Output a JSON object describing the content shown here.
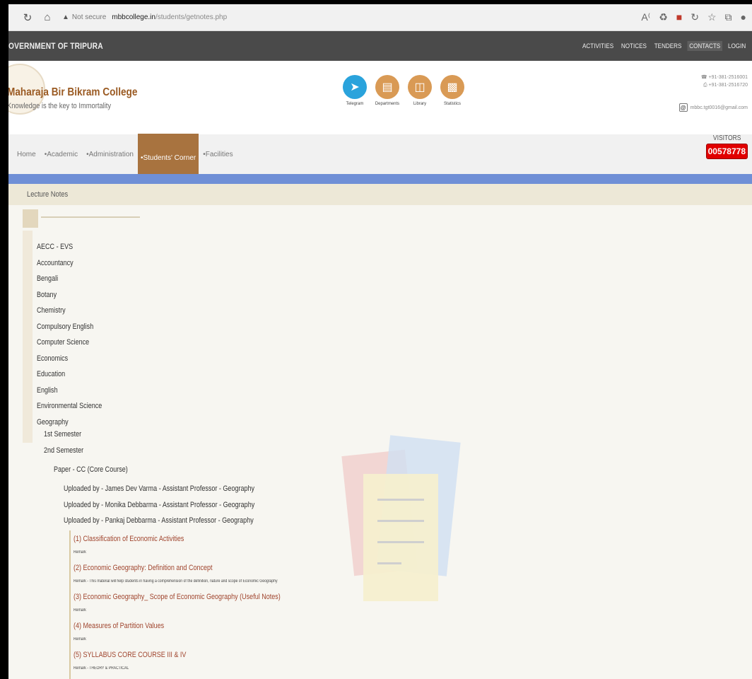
{
  "browser": {
    "not_secure": "Not secure",
    "host": "mbbcollege.in",
    "path": "/students/getnotes.php"
  },
  "govbar": {
    "title": "OVERNMENT OF TRIPURA",
    "links": [
      "ACTIVITIES",
      "NOTICES",
      "TENDERS",
      "CONTACTS",
      "LOGIN"
    ]
  },
  "header": {
    "college_name": "Maharaja Bir Bikram College",
    "tagline": "Knowledge is the key to Immortality",
    "quick_links": [
      {
        "label": "Telegram",
        "icon": "telegram-icon",
        "color": "#2aa3dc"
      },
      {
        "label": "Departments",
        "icon": "departments-icon",
        "color": "#d99a55"
      },
      {
        "label": "Library",
        "icon": "library-icon",
        "color": "#d99a55"
      },
      {
        "label": "Statistics",
        "icon": "statistics-icon",
        "color": "#d99a55"
      }
    ],
    "phone1": "+91-381-2516001",
    "phone2": "+91-381-2516720",
    "email": "mbbc.tgt0016@gmail.com"
  },
  "nav": {
    "items": [
      "Home",
      "•Academic",
      "•Administration",
      "•Students' Corner",
      "•Facilities"
    ],
    "active_index": 3,
    "visitors_label": "VISITORS",
    "visitors_count": "00578778"
  },
  "content": {
    "heading": "Lecture Notes",
    "subjects": [
      "AECC - EVS",
      "Accountancy",
      "Bengali",
      "Botany",
      "Chemistry",
      "Compulsory English",
      "Computer Science",
      "Economics",
      "Education",
      "English",
      "Environmental Science",
      "Geography"
    ],
    "semesters": [
      "1st Semester",
      "2nd Semester"
    ],
    "paper": "Paper - CC (Core Course)",
    "uploaders": [
      "Uploaded by - James Dev Varma - Assistant Professor - Geography",
      "Uploaded by - Monika Debbarma - Assistant Professor - Geography",
      "Uploaded by - Pankaj Debbarma - Assistant Professor - Geography"
    ],
    "notes": [
      {
        "title": "(1)  Classification of Economic Activities",
        "remark": "Remark"
      },
      {
        "title": "(2)  Economic Geography: Definition and Concept",
        "remark": "Remark - This material will help students in having a comprehension of the definition, nature and scope of Economic Geography"
      },
      {
        "title": "(3)  Economic Geography_ Scope of Economic Geography (Useful Notes)",
        "remark": "Remark"
      },
      {
        "title": "(4)  Measures of Partition Values",
        "remark": "Remark"
      },
      {
        "title": "(5)  SYLLABUS CORE COURSE III & IV",
        "remark": "Remark - THEORY & PRACTICAL"
      }
    ]
  }
}
